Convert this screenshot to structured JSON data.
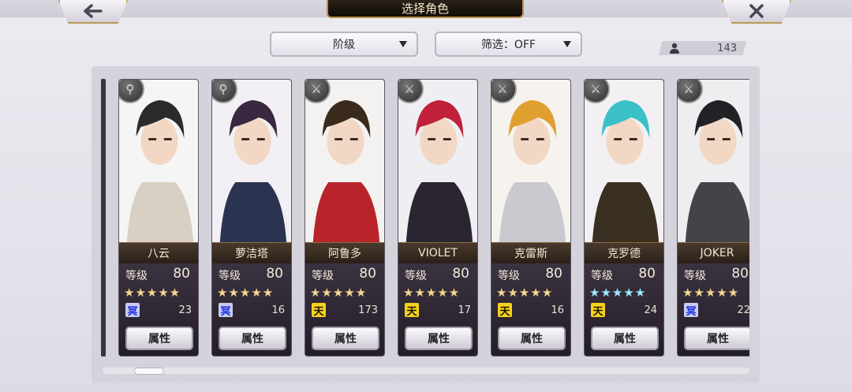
{
  "header": {
    "title": "选择角色",
    "back_icon": "arrow-left-icon",
    "close_icon": "close-x-icon"
  },
  "filters": {
    "rank_label": "阶级",
    "filter_label": "筛选：OFF"
  },
  "count": {
    "value": "143",
    "icon": "user-icon"
  },
  "common": {
    "level_label": "等级",
    "attribute_label": "属性"
  },
  "characters": [
    {
      "name": "八云",
      "level": "80",
      "stars": "★★★★★",
      "star_color": "#f3d890",
      "grade": "冥",
      "grade_type": "blue",
      "count": "23",
      "weapon": "summon",
      "palette": [
        "#f5f5f5",
        "#2b2b2b",
        "#d8d0c2"
      ]
    },
    {
      "name": "萝洁塔",
      "level": "80",
      "stars": "★★★★★",
      "star_color": "#f3d890",
      "grade": "冥",
      "grade_type": "blue",
      "count": "16",
      "weapon": "summon",
      "palette": [
        "#f2f0f4",
        "#3a2740",
        "#2a3450"
      ]
    },
    {
      "name": "阿鲁多",
      "level": "80",
      "stars": "★★★★★",
      "star_color": "#f3d890",
      "grade": "天",
      "grade_type": "gold",
      "count": "173",
      "weapon": "sword",
      "palette": [
        "#f4f2f0",
        "#3a2a1c",
        "#b8242a"
      ]
    },
    {
      "name": "VIOLET",
      "level": "80",
      "stars": "★★★★★",
      "star_color": "#f3d890",
      "grade": "天",
      "grade_type": "gold",
      "count": "17",
      "weapon": "sword",
      "palette": [
        "#efeef2",
        "#c0203a",
        "#2a2530"
      ]
    },
    {
      "name": "克雷斯",
      "level": "80",
      "stars": "★★★★★",
      "star_color": "#f3d890",
      "grade": "天",
      "grade_type": "gold",
      "count": "16",
      "weapon": "sword",
      "palette": [
        "#f6f3ee",
        "#e0a030",
        "#c9c9cf"
      ]
    },
    {
      "name": "克罗德",
      "level": "80",
      "stars": "★★★★★",
      "star_color": "#9ee8ff",
      "grade": "天",
      "grade_type": "gold",
      "count": "24",
      "weapon": "sword",
      "palette": [
        "#f2f0f2",
        "#3cc0c8",
        "#3a3022"
      ]
    },
    {
      "name": "JOKER",
      "level": "80",
      "stars": "★★★★★",
      "star_color": "#f3d890",
      "grade": "冥",
      "grade_type": "blue",
      "count": "22",
      "weapon": "sword",
      "palette": [
        "#eeedf0",
        "#222226",
        "#444448"
      ]
    }
  ]
}
